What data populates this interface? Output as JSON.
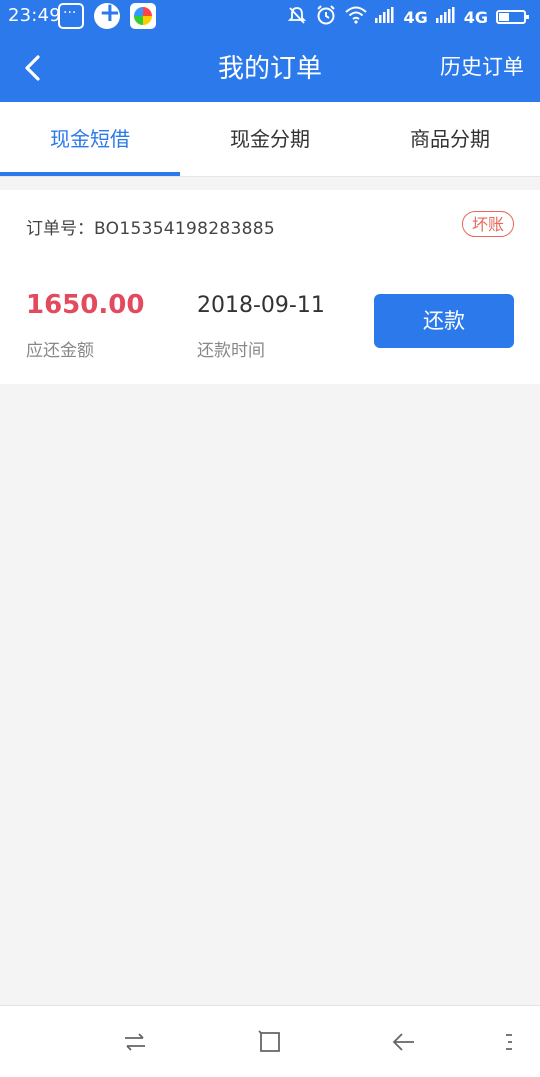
{
  "status_bar": {
    "time": "23:49",
    "network_1": "4G",
    "network_2": "4G",
    "icons": [
      "message-icon",
      "plus-icon",
      "app-360-icon",
      "mute-icon",
      "alarm-icon",
      "wifi-icon",
      "signal-icon",
      "battery-icon"
    ]
  },
  "header": {
    "title": "我的订单",
    "right_action": "历史订单"
  },
  "tabs": [
    {
      "label": "现金短借",
      "active": true
    },
    {
      "label": "现金分期",
      "active": false
    },
    {
      "label": "商品分期",
      "active": false
    }
  ],
  "order": {
    "order_no_label": "订单号：",
    "order_no": "BO15354198283885",
    "status": "坏账",
    "amount": "1650.00",
    "amount_label": "应还金额",
    "date": "2018-09-11",
    "date_label": "还款时间",
    "action": "还款"
  },
  "colors": {
    "primary": "#2b79ea",
    "amount": "#e44a5e",
    "badge": "#e8675a",
    "background": "#f4f4f4"
  },
  "nav_bar": {
    "icons": [
      "switch-icon",
      "home-square-icon",
      "back-arrow-icon",
      "menu-icon"
    ]
  }
}
